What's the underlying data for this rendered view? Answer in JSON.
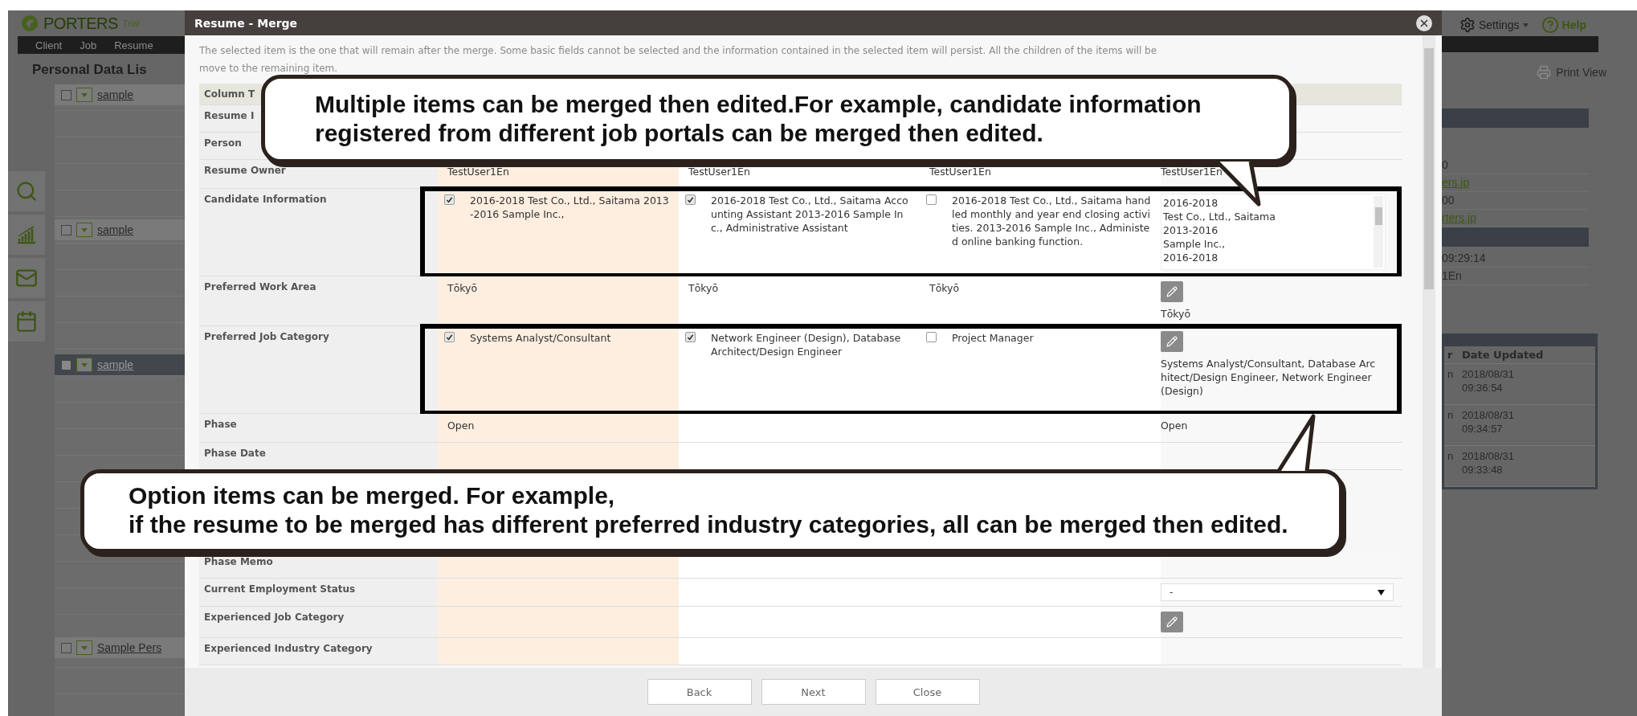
{
  "app": {
    "logo": "PORTERS",
    "logo_badge": "Trial",
    "nav": [
      "Client",
      "Job",
      "Resume"
    ],
    "page_title": "Personal Data Lis",
    "list_items": [
      {
        "label": "sample",
        "selected": false
      },
      {
        "label": "sample",
        "selected": false
      },
      {
        "label": "sample",
        "selected": true
      },
      {
        "label": "Sample Pers",
        "selected": false
      }
    ],
    "settings": "Settings",
    "help": "Help",
    "print_view": "Print View",
    "detail_sections": [
      {
        "lines": [
          {
            "text": "0",
            "kind": "text"
          },
          {
            "text": "ers.jp",
            "kind": "link"
          },
          {
            "text": "00",
            "kind": "text"
          },
          {
            "text": "rters.jp",
            "kind": "link"
          }
        ]
      },
      {
        "lines": [
          {
            "text": "09:29:14",
            "kind": "text"
          },
          {
            "text": "1En",
            "kind": "text"
          }
        ]
      }
    ],
    "history_table": {
      "columns": [
        "r",
        "Date Updated"
      ],
      "rows": [
        {
          "cells": [
            "n",
            "2018/08/31 09:36:54"
          ]
        },
        {
          "cells": [
            "n",
            "2018/08/31 09:34:57"
          ]
        },
        {
          "cells": [
            "n",
            "2018/08/31 09:33:48"
          ]
        }
      ]
    }
  },
  "dialog": {
    "title": "Resume - Merge",
    "intro": "The selected item is the one that will remain after the merge. Some basic fields cannot be selected and the information contained in the selected item will persist. All the children of the items will be move to the remaining item.",
    "rows": [
      {
        "label": "Column T",
        "kind": "header",
        "framed": false
      },
      {
        "label": "Resume I",
        "kind": "blank",
        "framed": false
      },
      {
        "label": "Person",
        "kind": "blank",
        "framed": false
      },
      {
        "label": "Resume Owner",
        "kind": "text",
        "framed": false,
        "cells": [
          {
            "text": "TestUser1En"
          },
          {
            "text": "TestUser1En"
          },
          {
            "text": "TestUser1En"
          }
        ],
        "result": {
          "kind": "text",
          "text": "TestUser1En"
        }
      },
      {
        "label": "Candidate Information",
        "kind": "choice",
        "framed": true,
        "cells": [
          {
            "text": "2016-2018 Test Co., Ltd., Saitama 2013-2016 Sample Inc.,",
            "checked": true
          },
          {
            "text": "2016-2018 Test Co., Ltd., Saitama Accounting Assistant 2013-2016 Sample Inc., Administrative Assistant",
            "checked": true
          },
          {
            "text": "2016-2018 Test Co., Ltd., Saitama handled monthly and year end closing activities. 2013-2016 Sample Inc., Administed online banking function.",
            "checked": false
          }
        ],
        "result": {
          "kind": "textarea",
          "text": "2016-2018\nTest Co., Ltd., Saitama\n2013-2016\nSample Inc.,\n2016-2018"
        }
      },
      {
        "label": "Preferred Work Area",
        "kind": "text",
        "framed": false,
        "cells": [
          {
            "text": "Tōkyō"
          },
          {
            "text": "Tōkyō"
          },
          {
            "text": "Tōkyō"
          }
        ],
        "result": {
          "kind": "edit",
          "text": "Tōkyō"
        }
      },
      {
        "label": "Preferred Job Category",
        "kind": "choice",
        "framed": true,
        "cells": [
          {
            "text": "Systems Analyst/Consultant",
            "checked": true
          },
          {
            "text": "Network Engineer (Design), Database Architect/Design Engineer",
            "checked": true
          },
          {
            "text": "Project Manager",
            "checked": false
          }
        ],
        "result": {
          "kind": "edit",
          "text": "Systems Analyst/Consultant, Database Architect/Design Engineer, Network Engineer (Design)"
        }
      },
      {
        "label": "Phase",
        "kind": "text",
        "framed": false,
        "cells": [
          {
            "text": "Open"
          }
        ],
        "result": {
          "kind": "text",
          "text": "Open"
        }
      },
      {
        "label": "Phase Date",
        "kind": "covered",
        "framed": false
      },
      {
        "label": "Phase Memo",
        "kind": "blank",
        "framed": false
      },
      {
        "label": "Current Employment Status",
        "kind": "blank",
        "framed": false,
        "result": {
          "kind": "select",
          "text": "-"
        }
      },
      {
        "label": "Experienced Job Category",
        "kind": "blank",
        "framed": false,
        "result": {
          "kind": "edit"
        }
      },
      {
        "label": "Experienced Industry Category",
        "kind": "blank",
        "framed": false
      }
    ],
    "buttons": [
      "Back",
      "Next",
      "Close"
    ]
  },
  "callouts": [
    {
      "lines": [
        "Multiple items can be merged then edited.For example, candidate information",
        "registered from different job portals can be merged then edited."
      ]
    },
    {
      "lines": [
        "Option items can be merged. For example,",
        "if the resume to be merged has different preferred industry categories, all can be merged then edited."
      ]
    }
  ]
}
